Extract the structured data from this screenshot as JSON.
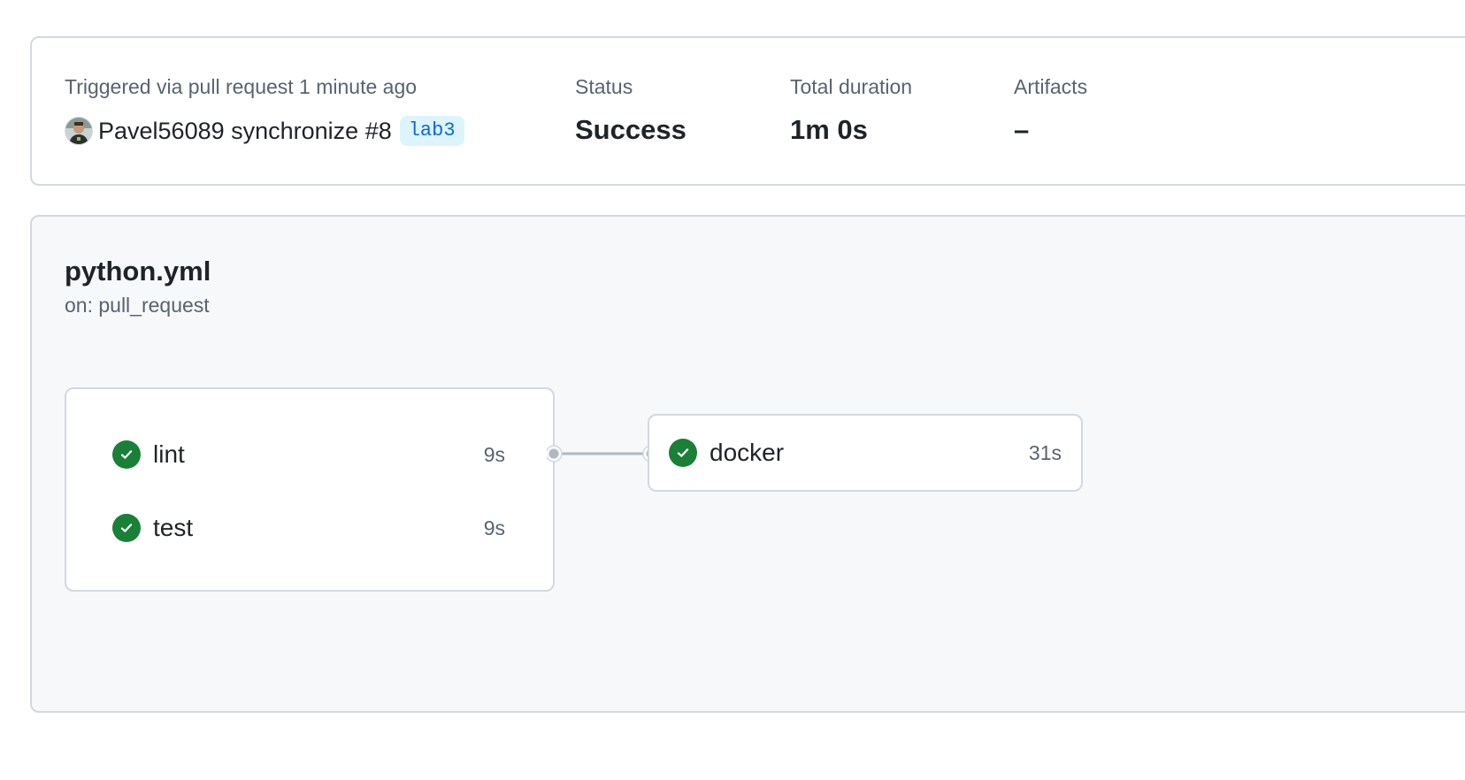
{
  "summary": {
    "trigger_label": "Triggered via pull request 1 minute ago",
    "actor_text": "Pavel56089 synchronize #8",
    "branch": "lab3",
    "status_label": "Status",
    "status_value": "Success",
    "duration_label": "Total duration",
    "duration_value": "1m 0s",
    "artifacts_label": "Artifacts",
    "artifacts_value": "–"
  },
  "workflow": {
    "file": "python.yml",
    "trigger": "on: pull_request",
    "jobs": [
      {
        "name": "lint",
        "duration": "9s",
        "status": "success"
      },
      {
        "name": "test",
        "duration": "9s",
        "status": "success"
      },
      {
        "name": "docker",
        "duration": "31s",
        "status": "success"
      }
    ]
  },
  "colors": {
    "success": "#1a7f37",
    "branch_bg": "#ddf4ff",
    "branch_text": "#0969da",
    "panel_bg": "#f6f8fa",
    "border": "#d1d9e0"
  }
}
